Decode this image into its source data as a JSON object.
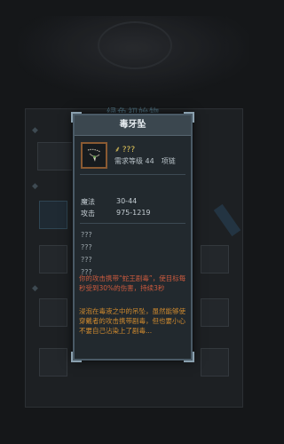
{
  "background": {
    "panel_title": "绿色初始物"
  },
  "tooltip": {
    "title": "毒牙坠",
    "item_name": "???",
    "requirement": "需求等级 44",
    "item_type": "项链",
    "stats": [
      {
        "label": "魔法",
        "value": "30-44"
      },
      {
        "label": "攻击",
        "value": "975-1219"
      }
    ],
    "unknown_props": [
      "???",
      "???",
      "???",
      "???"
    ],
    "effect_text": "你的攻击携带“蛇王剧毒”，使目标每秒受到30%的伤害，持续3秒",
    "lore_text": "浸泡在毒液之中的吊坠，虽然能够使穿戴者的攻击携带剧毒，但也要小心不要自己沾染上了剧毒..."
  },
  "colors": {
    "title_bg": "#3b474f",
    "name_gold": "#e6c95a",
    "effect_red": "#cc5a3e",
    "lore_orange": "#d08a2e",
    "icon_border": "#8a5a32"
  },
  "icons": {
    "item": "fang-pendant-icon",
    "name_prefix": "wand-icon"
  }
}
